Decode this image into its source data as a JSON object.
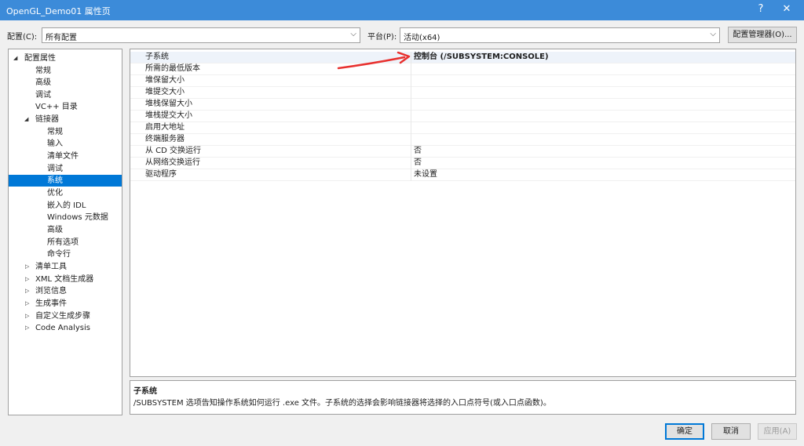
{
  "window": {
    "title": "OpenGL_Demo01 属性页",
    "help": "?",
    "close": "✕"
  },
  "toolbar": {
    "config_label": "配置(C):",
    "config_value": "所有配置",
    "platform_label": "平台(P):",
    "platform_value": "活动(x64)",
    "config_manager": "配置管理器(O)..."
  },
  "tree": {
    "items": [
      {
        "label": "配置属性",
        "expander": "◢"
      },
      {
        "label": "常规"
      },
      {
        "label": "高级"
      },
      {
        "label": "调试"
      },
      {
        "label": "VC++ 目录"
      },
      {
        "label": "链接器",
        "expander": "◢"
      },
      {
        "label": "常规"
      },
      {
        "label": "输入"
      },
      {
        "label": "清单文件"
      },
      {
        "label": "调试"
      },
      {
        "label": "系统",
        "selected": true
      },
      {
        "label": "优化"
      },
      {
        "label": "嵌入的 IDL"
      },
      {
        "label": "Windows 元数据"
      },
      {
        "label": "高级"
      },
      {
        "label": "所有选项"
      },
      {
        "label": "命令行"
      },
      {
        "label": "清单工具",
        "expander": "▷"
      },
      {
        "label": "XML 文档生成器",
        "expander": "▷"
      },
      {
        "label": "浏览信息",
        "expander": "▷"
      },
      {
        "label": "生成事件",
        "expander": "▷"
      },
      {
        "label": "自定义生成步骤",
        "expander": "▷"
      },
      {
        "label": "Code Analysis",
        "expander": "▷"
      }
    ]
  },
  "properties": {
    "rows": [
      {
        "name": "子系统",
        "value": "控制台 (/SUBSYSTEM:CONSOLE)"
      },
      {
        "name": "所需的最低版本",
        "value": ""
      },
      {
        "name": "堆保留大小",
        "value": ""
      },
      {
        "name": "堆提交大小",
        "value": ""
      },
      {
        "name": "堆栈保留大小",
        "value": ""
      },
      {
        "name": "堆栈提交大小",
        "value": ""
      },
      {
        "name": "启用大地址",
        "value": ""
      },
      {
        "name": "终端服务器",
        "value": ""
      },
      {
        "name": "从 CD 交换运行",
        "value": "否"
      },
      {
        "name": "从网络交换运行",
        "value": "否"
      },
      {
        "name": "驱动程序",
        "value": "未设置"
      }
    ]
  },
  "description": {
    "title": "子系统",
    "text": "/SUBSYSTEM 选项告知操作系统如何运行 .exe 文件。子系统的选择会影响链接器将选择的入口点符号(或入口点函数)。"
  },
  "buttons": {
    "ok": "确定",
    "cancel": "取消",
    "apply": "应用(A)"
  },
  "colors": {
    "titlebar": "#3c8bd9",
    "selection": "#0078d7",
    "annotation_arrow": "#e8302e"
  }
}
